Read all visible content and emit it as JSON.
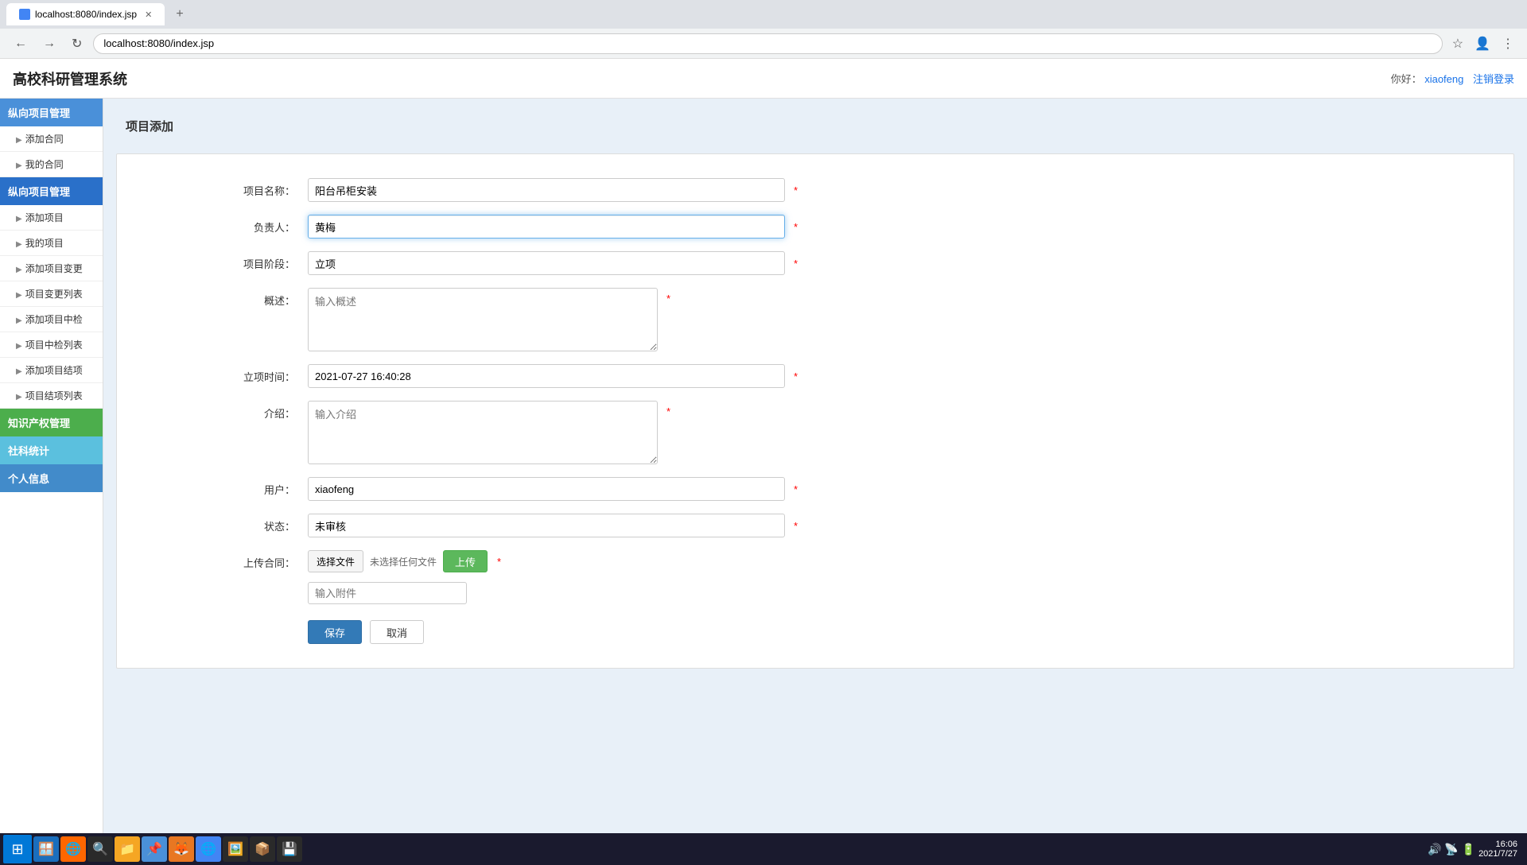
{
  "browser": {
    "tab_title": "localhost:8080/index.jsp",
    "url": "localhost:8080/index.jsp",
    "favicon": "🌐"
  },
  "app": {
    "title": "高校科研管理系统",
    "user_greeting": "你好：",
    "username": "xiaofeng",
    "logout_link": "注销登录"
  },
  "sidebar": {
    "sections": [
      {
        "id": "contract",
        "label": "纵向项目管理",
        "active": false,
        "items": [
          "添加合同",
          "我的合同"
        ]
      },
      {
        "id": "project",
        "label": "纵向项目管理",
        "active": true,
        "items": [
          "添加项目",
          "我的项目",
          "添加项目变更",
          "项目变更列表",
          "添加项目中检",
          "项目中检列表",
          "添加项目结项",
          "项目结项列表"
        ]
      },
      {
        "id": "ipr",
        "label": "知识产权管理",
        "active": false,
        "items": []
      },
      {
        "id": "stats",
        "label": "社科统计",
        "active": false,
        "items": []
      },
      {
        "id": "profile",
        "label": "个人信息",
        "active": false,
        "items": []
      }
    ]
  },
  "page": {
    "title": "项目添加",
    "breadcrumb": "项目添加"
  },
  "form": {
    "fields": {
      "project_name_label": "项目名称：",
      "project_name_value": "阳台吊柜安装",
      "responsible_person_label": "负责人：",
      "responsible_person_value": "黄梅",
      "project_stage_label": "项目阶段：",
      "project_stage_value": "立项",
      "abstract_label": "概述：",
      "abstract_placeholder": "输入概述",
      "start_time_label": "立项时间：",
      "start_time_value": "2021-07-27 16:40:28",
      "intro_label": "介绍：",
      "intro_placeholder": "输入介绍",
      "user_label": "用户：",
      "user_value": "xiaofeng",
      "status_label": "状态：",
      "status_value": "未审核",
      "upload_label": "上传合同：",
      "upload_btn": "选择文件",
      "upload_status": "未选择任何文件",
      "upload_submit": "上传",
      "attachment_placeholder": "输入附件"
    },
    "buttons": {
      "save": "保存",
      "cancel": "取消"
    }
  },
  "taskbar": {
    "time": "16:06",
    "date": "2021/7/27",
    "icons": [
      "🪟",
      "🌐",
      "🔍",
      "📁",
      "📌",
      "🦊",
      "🌐",
      "🖼️",
      "📦",
      "💾"
    ]
  }
}
